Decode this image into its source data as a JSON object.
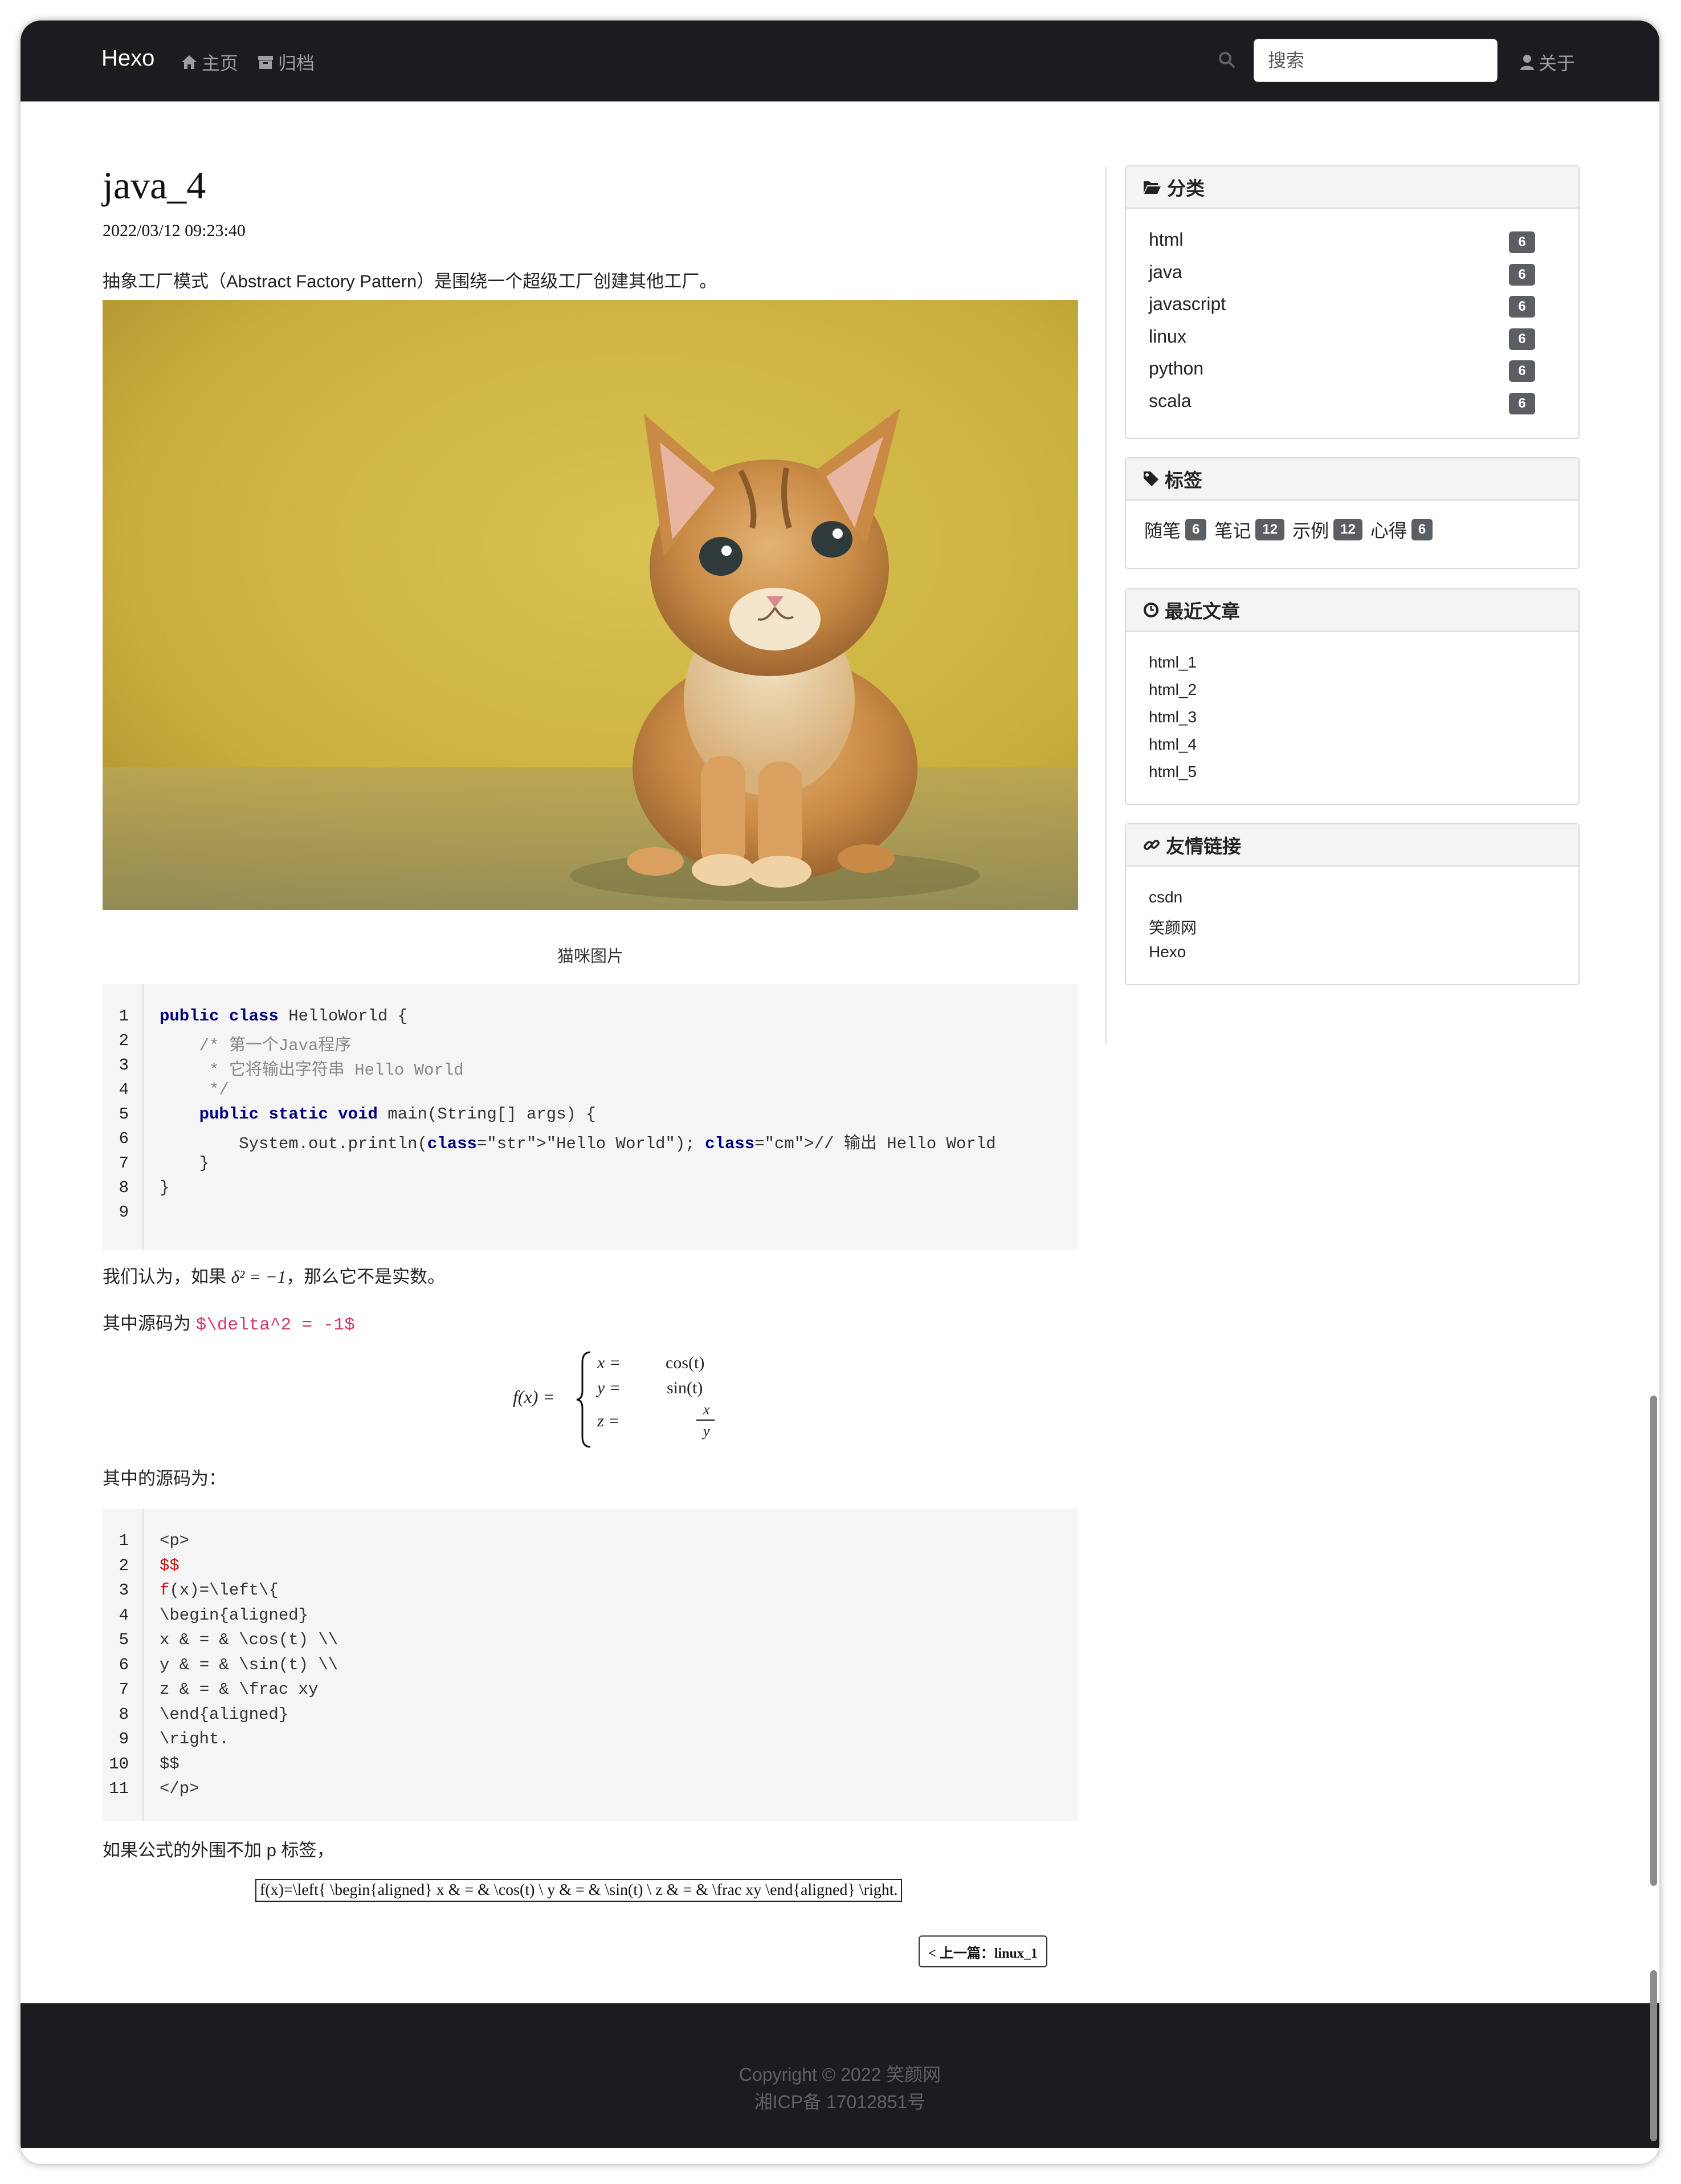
{
  "nav": {
    "brand": "Hexo",
    "home": "主页",
    "archive": "归档",
    "search_placeholder": "搜索",
    "about": "关于"
  },
  "article": {
    "title": "java_4",
    "date": "2022/03/12 09:23:40",
    "intro": "抽象工厂模式（Abstract Factory Pattern）是围绕一个超级工厂创建其他工厂。",
    "image_caption": "猫咪图片",
    "code1": {
      "line_numbers": [
        "1",
        "2",
        "3",
        "4",
        "5",
        "6",
        "7",
        "8",
        "9"
      ],
      "lines": [
        "public class HelloWorld {",
        "    /* 第一个Java程序",
        "     * 它将输出字符串 Hello World",
        "     */",
        "    public static void main(String[] args) {",
        "        System.out.println(\"Hello World\"); // 输出 Hello World",
        "    }",
        "}",
        ""
      ]
    },
    "para_delta_prefix": "我们认为，如果 ",
    "para_delta_math": "δ² = −1",
    "para_delta_suffix": "，那么它不是实数。",
    "para_source_prefix": "其中源码为 ",
    "para_source_code": "$\\delta^2 = -1$",
    "formula": {
      "lhs": "f(x) =",
      "rows": [
        {
          "var": "x =",
          "rhs": "cos(t)"
        },
        {
          "var": "y =",
          "rhs": "sin(t)"
        },
        {
          "var": "z =",
          "num": "x",
          "den": "y"
        }
      ]
    },
    "para_source2": "其中的源码为：",
    "code2": {
      "line_numbers": [
        "1",
        "2",
        "3",
        "4",
        "5",
        "6",
        "7",
        "8",
        "9",
        "10",
        "11"
      ],
      "lines": [
        "<p>",
        "$$",
        "f(x)=\\left\\{",
        "\\begin{aligned}",
        "x & = & \\cos(t) \\\\",
        "y & = & \\sin(t) \\\\",
        "z & = & \\frac xy",
        "\\end{aligned}",
        "\\right.",
        "$$",
        "</p>"
      ]
    },
    "para_no_p": "如果公式的外围不加 p 标签，",
    "boxed_formula": "f(x)=\\left{ \\begin{aligned} x & = & \\cos(t) \\ y & = & \\sin(t) \\ z & = & \\frac xy \\end{aligned} \\right.",
    "prev_link": "< 上一篇：linux_1"
  },
  "sidebar": {
    "categories": {
      "title": "分类",
      "items": [
        {
          "label": "html",
          "count": "6"
        },
        {
          "label": "java",
          "count": "6"
        },
        {
          "label": "javascript",
          "count": "6"
        },
        {
          "label": "linux",
          "count": "6"
        },
        {
          "label": "python",
          "count": "6"
        },
        {
          "label": "scala",
          "count": "6"
        }
      ]
    },
    "tags": {
      "title": "标签",
      "items": [
        {
          "label": "随笔",
          "count": "6"
        },
        {
          "label": "笔记",
          "count": "12"
        },
        {
          "label": "示例",
          "count": "12"
        },
        {
          "label": "心得",
          "count": "6"
        }
      ]
    },
    "recent": {
      "title": "最近文章",
      "items": [
        "html_1",
        "html_2",
        "html_3",
        "html_4",
        "html_5"
      ]
    },
    "links": {
      "title": "友情链接",
      "items": [
        "csdn",
        "笑颜网",
        "Hexo"
      ]
    }
  },
  "footer": {
    "copyright": "Copyright © 2022 笑颜网",
    "icp": "湘ICP备 17012851号"
  },
  "colors": {
    "navbar_bg": "#1a1c1f",
    "badge_bg": "#5b5f64",
    "keyword": "#000080",
    "string": "#008000",
    "inline_code": "#d6336c"
  }
}
